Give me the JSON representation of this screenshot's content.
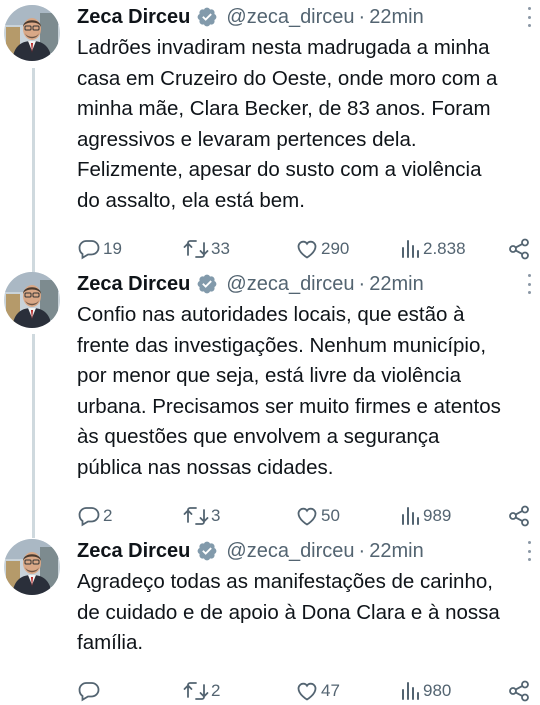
{
  "tweets": [
    {
      "name": "Zeca Dirceu",
      "handle": "@zeca_dirceu",
      "separator": "·",
      "time": "22min",
      "lines": [
        "Ladrões invadiram nesta madrugada a minha",
        "casa em Cruzeiro do Oeste, onde moro com a",
        "minha mãe, Clara Becker, de 83 anos. Foram",
        "agressivos e levaram pertences dela.",
        "Felizmente, apesar do susto com a violência",
        "do assalto, ela está bem."
      ],
      "replies": "19",
      "retweets": "33",
      "likes": "290",
      "views": "2.838"
    },
    {
      "name": "Zeca Dirceu",
      "handle": "@zeca_dirceu",
      "separator": "·",
      "time": "22min",
      "lines": [
        "Confio nas autoridades locais, que estão à",
        "frente das investigações. Nenhum município,",
        "por menor que seja, está livre da violência",
        "urbana. Precisamos ser muito firmes e atentos",
        "às questões que envolvem a segurança",
        "pública nas nossas cidades."
      ],
      "replies": "2",
      "retweets": "3",
      "likes": "50",
      "views": "989"
    },
    {
      "name": "Zeca Dirceu",
      "handle": "@zeca_dirceu",
      "separator": "·",
      "time": "22min",
      "lines": [
        "Agradeço todas as manifestações de carinho,",
        "de cuidado e de apoio à Dona Clara e à nossa",
        "família."
      ],
      "replies": "",
      "retweets": "2",
      "likes": "47",
      "views": "980"
    }
  ],
  "icons": {
    "reply": "reply-icon",
    "retweet": "retweet-icon",
    "like": "heart-icon",
    "views": "views-icon",
    "share": "share-icon",
    "verified": "verified-badge-icon",
    "more": "more-options-icon"
  },
  "colors": {
    "text": "#0f1419",
    "muted": "#536471",
    "thread_line": "#cfd9de",
    "verified_badge": "#829aab"
  }
}
